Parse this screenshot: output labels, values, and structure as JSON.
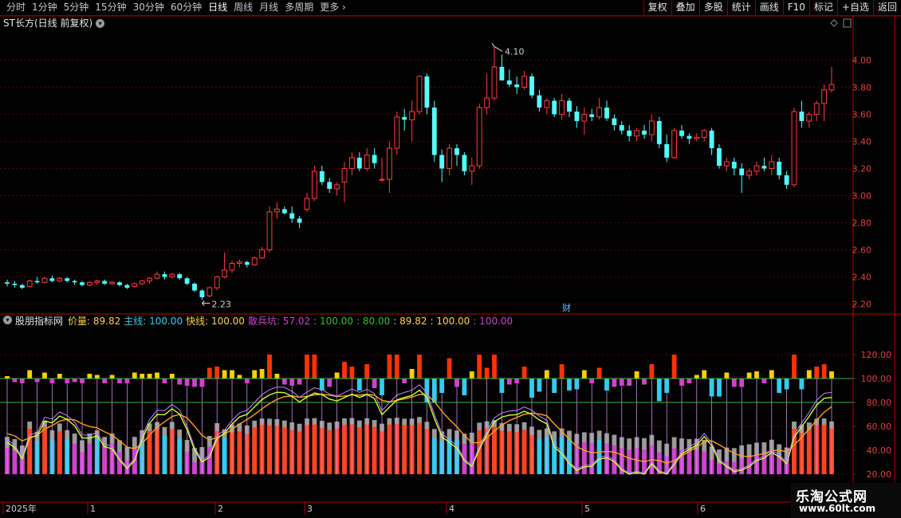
{
  "toolbar": {
    "periods": [
      "分时",
      "1分钟",
      "5分钟",
      "15分钟",
      "30分钟",
      "60分钟",
      "日线",
      "周线",
      "月线",
      "多周期",
      "更多"
    ],
    "active_period": "日线",
    "right_buttons": [
      "复权",
      "叠加",
      "多股",
      "统计",
      "画线",
      "F10",
      "标记",
      "+自选",
      "返回"
    ]
  },
  "main_title": "ST长方(日线 前复权)",
  "high_label": "4.10",
  "low_label": "2.23",
  "fin_marker": "财",
  "indicator": {
    "name": "股朋指标网",
    "legend": [
      {
        "label": "价量:",
        "value": "89.82",
        "color": "#ffd24a"
      },
      {
        "label": "主线:",
        "value": "100.00",
        "color": "#33ccee"
      },
      {
        "label": "快线:",
        "value": "100.00",
        "color": "#ffd24a"
      },
      {
        "label": "散兵坑:",
        "value": "57.02",
        "color": "#d040d0"
      },
      {
        "label": ":",
        "value": "100.00",
        "color": "#30c030"
      },
      {
        "label": ":",
        "value": "80.00",
        "color": "#30c030"
      },
      {
        "label": ":",
        "value": "89.82",
        "color": "#ffd24a"
      },
      {
        "label": ":",
        "value": "100.00",
        "color": "#ffd24a"
      },
      {
        "label": ":",
        "value": "100.00",
        "color": "#d040d0"
      }
    ]
  },
  "x_labels": [
    "2025年",
    "1",
    "2",
    "3",
    "4",
    "5",
    "6"
  ],
  "watermark": {
    "line1": "乐淘公式网",
    "line2": "www.60lt.com"
  },
  "colors": {
    "up": "#ff3c3c",
    "down": "#54ffff",
    "grid": "#5a0000",
    "axis": "#b00000"
  },
  "chart_data": [
    {
      "type": "candlestick",
      "title": "ST长方(日线 前复权)",
      "y_ticks": [
        2.2,
        2.4,
        2.6,
        2.8,
        3.0,
        3.2,
        3.4,
        3.6,
        3.8,
        4.0
      ],
      "ylim": [
        2.15,
        4.22
      ],
      "candles": [
        [
          2.36,
          2.38,
          2.33,
          2.35
        ],
        [
          2.35,
          2.37,
          2.32,
          2.34
        ],
        [
          2.34,
          2.35,
          2.31,
          2.32
        ],
        [
          2.33,
          2.38,
          2.32,
          2.37
        ],
        [
          2.37,
          2.4,
          2.35,
          2.36
        ],
        [
          2.36,
          2.4,
          2.35,
          2.39
        ],
        [
          2.39,
          2.41,
          2.36,
          2.37
        ],
        [
          2.37,
          2.4,
          2.36,
          2.39
        ],
        [
          2.39,
          2.4,
          2.36,
          2.37
        ],
        [
          2.37,
          2.38,
          2.34,
          2.36
        ],
        [
          2.36,
          2.37,
          2.33,
          2.34
        ],
        [
          2.34,
          2.37,
          2.33,
          2.36
        ],
        [
          2.36,
          2.38,
          2.34,
          2.37
        ],
        [
          2.37,
          2.38,
          2.34,
          2.35
        ],
        [
          2.35,
          2.37,
          2.34,
          2.36
        ],
        [
          2.36,
          2.37,
          2.33,
          2.34
        ],
        [
          2.34,
          2.35,
          2.31,
          2.32
        ],
        [
          2.33,
          2.36,
          2.32,
          2.35
        ],
        [
          2.35,
          2.38,
          2.34,
          2.37
        ],
        [
          2.37,
          2.4,
          2.35,
          2.39
        ],
        [
          2.39,
          2.44,
          2.38,
          2.42
        ],
        [
          2.42,
          2.44,
          2.38,
          2.4
        ],
        [
          2.4,
          2.43,
          2.39,
          2.42
        ],
        [
          2.42,
          2.43,
          2.38,
          2.39
        ],
        [
          2.39,
          2.4,
          2.34,
          2.35
        ],
        [
          2.35,
          2.36,
          2.29,
          2.3
        ],
        [
          2.3,
          2.31,
          2.23,
          2.25
        ],
        [
          2.26,
          2.33,
          2.25,
          2.32
        ],
        [
          2.32,
          2.41,
          2.3,
          2.4
        ],
        [
          2.4,
          2.58,
          2.39,
          2.45
        ],
        [
          2.45,
          2.52,
          2.43,
          2.5
        ],
        [
          2.5,
          2.53,
          2.47,
          2.51
        ],
        [
          2.51,
          2.52,
          2.47,
          2.49
        ],
        [
          2.49,
          2.55,
          2.48,
          2.54
        ],
        [
          2.54,
          2.62,
          2.53,
          2.6
        ],
        [
          2.6,
          2.92,
          2.58,
          2.88
        ],
        [
          2.88,
          2.95,
          2.83,
          2.9
        ],
        [
          2.9,
          2.92,
          2.86,
          2.87
        ],
        [
          2.87,
          2.92,
          2.8,
          2.83
        ],
        [
          2.83,
          2.85,
          2.76,
          2.8
        ],
        [
          2.9,
          3.02,
          2.88,
          2.98
        ],
        [
          2.98,
          3.22,
          2.96,
          3.18
        ],
        [
          3.18,
          3.22,
          3.08,
          3.1
        ],
        [
          3.1,
          3.13,
          3.02,
          3.05
        ],
        [
          3.05,
          3.1,
          3.0,
          3.08
        ],
        [
          3.1,
          3.25,
          2.95,
          3.2
        ],
        [
          3.2,
          3.32,
          3.15,
          3.28
        ],
        [
          3.28,
          3.32,
          3.18,
          3.2
        ],
        [
          3.2,
          3.35,
          3.18,
          3.3
        ],
        [
          3.3,
          3.35,
          3.2,
          3.24
        ],
        [
          3.12,
          3.28,
          3.1,
          3.12
        ],
        [
          3.12,
          3.4,
          3.02,
          3.35
        ],
        [
          3.35,
          3.62,
          3.3,
          3.58
        ],
        [
          3.58,
          3.64,
          3.48,
          3.56
        ],
        [
          3.56,
          3.7,
          3.4,
          3.62
        ],
        [
          3.62,
          3.89,
          3.6,
          3.88
        ],
        [
          3.88,
          3.9,
          3.6,
          3.65
        ],
        [
          3.65,
          3.7,
          3.25,
          3.3
        ],
        [
          3.3,
          3.34,
          3.1,
          3.2
        ],
        [
          3.2,
          3.38,
          3.15,
          3.35
        ],
        [
          3.35,
          3.38,
          3.22,
          3.3
        ],
        [
          3.3,
          3.32,
          3.15,
          3.18
        ],
        [
          3.18,
          3.28,
          3.08,
          3.22
        ],
        [
          3.22,
          3.68,
          3.2,
          3.65
        ],
        [
          3.65,
          3.9,
          3.6,
          3.72
        ],
        [
          3.72,
          4.1,
          3.7,
          3.95
        ],
        [
          3.95,
          4.04,
          3.85,
          3.85
        ],
        [
          3.85,
          3.93,
          3.8,
          3.82
        ],
        [
          3.82,
          3.88,
          3.75,
          3.8
        ],
        [
          3.8,
          3.92,
          3.78,
          3.88
        ],
        [
          3.88,
          3.9,
          3.72,
          3.74
        ],
        [
          3.74,
          3.78,
          3.62,
          3.65
        ],
        [
          3.65,
          3.72,
          3.6,
          3.7
        ],
        [
          3.7,
          3.72,
          3.58,
          3.6
        ],
        [
          3.6,
          3.75,
          3.56,
          3.7
        ],
        [
          3.7,
          3.72,
          3.58,
          3.62
        ],
        [
          3.62,
          3.66,
          3.5,
          3.55
        ],
        [
          3.55,
          3.65,
          3.45,
          3.6
        ],
        [
          3.6,
          3.64,
          3.55,
          3.58
        ],
        [
          3.58,
          3.72,
          3.56,
          3.65
        ],
        [
          3.65,
          3.7,
          3.55,
          3.57
        ],
        [
          3.57,
          3.6,
          3.48,
          3.52
        ],
        [
          3.52,
          3.55,
          3.45,
          3.48
        ],
        [
          3.48,
          3.52,
          3.4,
          3.44
        ],
        [
          3.44,
          3.5,
          3.4,
          3.48
        ],
        [
          3.48,
          3.52,
          3.42,
          3.45
        ],
        [
          3.45,
          3.6,
          3.4,
          3.55
        ],
        [
          3.55,
          3.58,
          3.35,
          3.38
        ],
        [
          3.38,
          3.45,
          3.25,
          3.28
        ],
        [
          3.28,
          3.5,
          3.27,
          3.48
        ],
        [
          3.48,
          3.52,
          3.42,
          3.44
        ],
        [
          3.44,
          3.46,
          3.38,
          3.42
        ],
        [
          3.42,
          3.46,
          3.4,
          3.43
        ],
        [
          3.43,
          3.49,
          3.4,
          3.48
        ],
        [
          3.48,
          3.5,
          3.3,
          3.35
        ],
        [
          3.35,
          3.38,
          3.2,
          3.22
        ],
        [
          3.22,
          3.28,
          3.18,
          3.25
        ],
        [
          3.25,
          3.28,
          3.15,
          3.2
        ],
        [
          3.2,
          3.24,
          3.02,
          3.15
        ],
        [
          3.15,
          3.2,
          3.12,
          3.18
        ],
        [
          3.18,
          3.25,
          3.15,
          3.22
        ],
        [
          3.22,
          3.28,
          3.18,
          3.2
        ],
        [
          3.2,
          3.3,
          3.15,
          3.25
        ],
        [
          3.25,
          3.28,
          3.12,
          3.15
        ],
        [
          3.15,
          3.18,
          3.05,
          3.08
        ],
        [
          3.08,
          3.65,
          3.06,
          3.62
        ],
        [
          3.62,
          3.7,
          3.5,
          3.55
        ],
        [
          3.55,
          3.62,
          3.5,
          3.6
        ],
        [
          3.6,
          3.7,
          3.55,
          3.68
        ],
        [
          3.68,
          3.82,
          3.55,
          3.78
        ],
        [
          3.78,
          3.95,
          3.76,
          3.82
        ]
      ]
    },
    {
      "type": "bar",
      "title": "股朋指标网",
      "y_ticks": [
        20.0,
        40.0,
        60.0,
        80.0,
        100.0,
        120.0
      ],
      "ylim": [
        20,
        142
      ],
      "ref_lines": [
        100,
        80
      ],
      "series_note": "价量 / 主线 / 快线 / 散兵坑"
    }
  ]
}
